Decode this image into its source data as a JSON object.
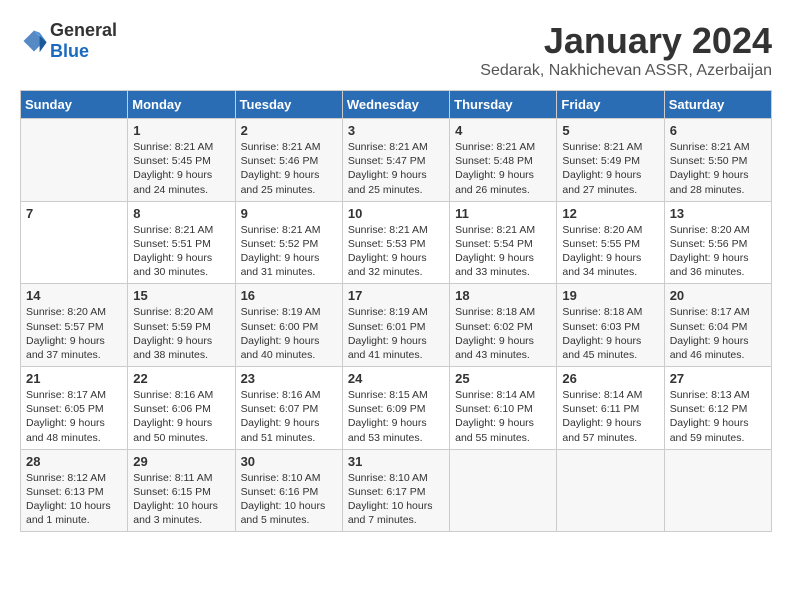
{
  "header": {
    "logo_general": "General",
    "logo_blue": "Blue",
    "title": "January 2024",
    "location": "Sedarak, Nakhichevan ASSR, Azerbaijan"
  },
  "days_of_week": [
    "Sunday",
    "Monday",
    "Tuesday",
    "Wednesday",
    "Thursday",
    "Friday",
    "Saturday"
  ],
  "weeks": [
    [
      {
        "day": "",
        "info": ""
      },
      {
        "day": "1",
        "info": "Sunrise: 8:21 AM\nSunset: 5:45 PM\nDaylight: 9 hours\nand 24 minutes."
      },
      {
        "day": "2",
        "info": "Sunrise: 8:21 AM\nSunset: 5:46 PM\nDaylight: 9 hours\nand 25 minutes."
      },
      {
        "day": "3",
        "info": "Sunrise: 8:21 AM\nSunset: 5:47 PM\nDaylight: 9 hours\nand 25 minutes."
      },
      {
        "day": "4",
        "info": "Sunrise: 8:21 AM\nSunset: 5:48 PM\nDaylight: 9 hours\nand 26 minutes."
      },
      {
        "day": "5",
        "info": "Sunrise: 8:21 AM\nSunset: 5:49 PM\nDaylight: 9 hours\nand 27 minutes."
      },
      {
        "day": "6",
        "info": "Sunrise: 8:21 AM\nSunset: 5:50 PM\nDaylight: 9 hours\nand 28 minutes."
      }
    ],
    [
      {
        "day": "7",
        "info": ""
      },
      {
        "day": "8",
        "info": "Sunrise: 8:21 AM\nSunset: 5:51 PM\nDaylight: 9 hours\nand 30 minutes."
      },
      {
        "day": "9",
        "info": "Sunrise: 8:21 AM\nSunset: 5:52 PM\nDaylight: 9 hours\nand 31 minutes."
      },
      {
        "day": "10",
        "info": "Sunrise: 8:21 AM\nSunset: 5:53 PM\nDaylight: 9 hours\nand 32 minutes."
      },
      {
        "day": "11",
        "info": "Sunrise: 8:21 AM\nSunset: 5:54 PM\nDaylight: 9 hours\nand 33 minutes."
      },
      {
        "day": "12",
        "info": "Sunrise: 8:20 AM\nSunset: 5:55 PM\nDaylight: 9 hours\nand 34 minutes."
      },
      {
        "day": "13",
        "info": "Sunrise: 8:20 AM\nSunset: 5:56 PM\nDaylight: 9 hours\nand 36 minutes."
      }
    ],
    [
      {
        "day": "14",
        "info": "Sunrise: 8:20 AM\nSunset: 5:57 PM\nDaylight: 9 hours\nand 37 minutes."
      },
      {
        "day": "15",
        "info": "Sunrise: 8:20 AM\nSunset: 5:59 PM\nDaylight: 9 hours\nand 38 minutes."
      },
      {
        "day": "16",
        "info": "Sunrise: 8:19 AM\nSunset: 6:00 PM\nDaylight: 9 hours\nand 40 minutes."
      },
      {
        "day": "17",
        "info": "Sunrise: 8:19 AM\nSunset: 6:01 PM\nDaylight: 9 hours\nand 41 minutes."
      },
      {
        "day": "18",
        "info": "Sunrise: 8:18 AM\nSunset: 6:02 PM\nDaylight: 9 hours\nand 43 minutes."
      },
      {
        "day": "19",
        "info": "Sunrise: 8:18 AM\nSunset: 6:03 PM\nDaylight: 9 hours\nand 45 minutes."
      },
      {
        "day": "20",
        "info": "Sunrise: 8:17 AM\nSunset: 6:04 PM\nDaylight: 9 hours\nand 46 minutes."
      }
    ],
    [
      {
        "day": "21",
        "info": "Sunrise: 8:17 AM\nSunset: 6:05 PM\nDaylight: 9 hours\nand 48 minutes."
      },
      {
        "day": "22",
        "info": "Sunrise: 8:16 AM\nSunset: 6:06 PM\nDaylight: 9 hours\nand 50 minutes."
      },
      {
        "day": "23",
        "info": "Sunrise: 8:16 AM\nSunset: 6:07 PM\nDaylight: 9 hours\nand 51 minutes."
      },
      {
        "day": "24",
        "info": "Sunrise: 8:15 AM\nSunset: 6:09 PM\nDaylight: 9 hours\nand 53 minutes."
      },
      {
        "day": "25",
        "info": "Sunrise: 8:14 AM\nSunset: 6:10 PM\nDaylight: 9 hours\nand 55 minutes."
      },
      {
        "day": "26",
        "info": "Sunrise: 8:14 AM\nSunset: 6:11 PM\nDaylight: 9 hours\nand 57 minutes."
      },
      {
        "day": "27",
        "info": "Sunrise: 8:13 AM\nSunset: 6:12 PM\nDaylight: 9 hours\nand 59 minutes."
      }
    ],
    [
      {
        "day": "28",
        "info": "Sunrise: 8:12 AM\nSunset: 6:13 PM\nDaylight: 10 hours\nand 1 minute."
      },
      {
        "day": "29",
        "info": "Sunrise: 8:11 AM\nSunset: 6:15 PM\nDaylight: 10 hours\nand 3 minutes."
      },
      {
        "day": "30",
        "info": "Sunrise: 8:10 AM\nSunset: 6:16 PM\nDaylight: 10 hours\nand 5 minutes."
      },
      {
        "day": "31",
        "info": "Sunrise: 8:10 AM\nSunset: 6:17 PM\nDaylight: 10 hours\nand 7 minutes."
      },
      {
        "day": "",
        "info": ""
      },
      {
        "day": "",
        "info": ""
      },
      {
        "day": "",
        "info": ""
      }
    ]
  ]
}
